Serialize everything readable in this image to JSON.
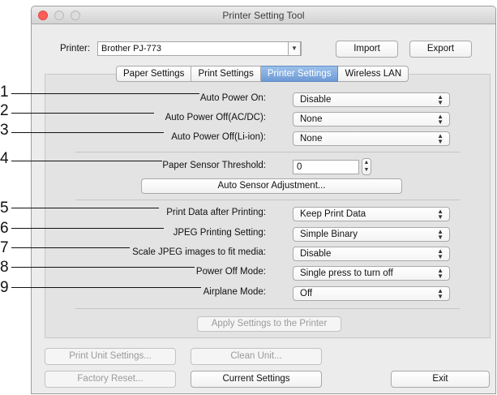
{
  "window": {
    "title": "Printer Setting Tool"
  },
  "printer": {
    "label": "Printer:",
    "value": "Brother PJ-773",
    "import_label": "Import",
    "export_label": "Export"
  },
  "tabs": [
    {
      "label": "Paper Settings",
      "active": false
    },
    {
      "label": "Print Settings",
      "active": false
    },
    {
      "label": "Printer Settings",
      "active": true
    },
    {
      "label": "Wireless LAN",
      "active": false
    }
  ],
  "settings": {
    "auto_power_on": {
      "label": "Auto Power On:",
      "value": "Disable"
    },
    "auto_power_off_acdc": {
      "label": "Auto Power Off(AC/DC):",
      "value": "None"
    },
    "auto_power_off_liion": {
      "label": "Auto Power Off(Li-ion):",
      "value": "None"
    },
    "paper_sensor_threshold": {
      "label": "Paper Sensor Threshold:",
      "value": "0"
    },
    "auto_sensor_adjustment_label": "Auto Sensor Adjustment...",
    "print_data_after_printing": {
      "label": "Print Data after Printing:",
      "value": "Keep Print Data"
    },
    "jpeg_printing_setting": {
      "label": "JPEG Printing Setting:",
      "value": "Simple Binary"
    },
    "scale_jpeg": {
      "label": "Scale JPEG images to fit media:",
      "value": "Disable"
    },
    "power_off_mode": {
      "label": "Power Off Mode:",
      "value": "Single press to turn off"
    },
    "airplane_mode": {
      "label": "Airplane Mode:",
      "value": "Off"
    }
  },
  "apply_label": "Apply Settings to the Printer",
  "bottom": {
    "print_unit_settings": "Print Unit Settings...",
    "clean_unit": "Clean Unit...",
    "factory_reset": "Factory Reset...",
    "current_settings": "Current Settings",
    "exit": "Exit"
  },
  "callouts": [
    "1",
    "2",
    "3",
    "4",
    "5",
    "6",
    "7",
    "8",
    "9"
  ],
  "colors": {
    "active_tab": "#6d9ad6",
    "close_button": "#fc5f57",
    "window_bg": "#ececec"
  }
}
